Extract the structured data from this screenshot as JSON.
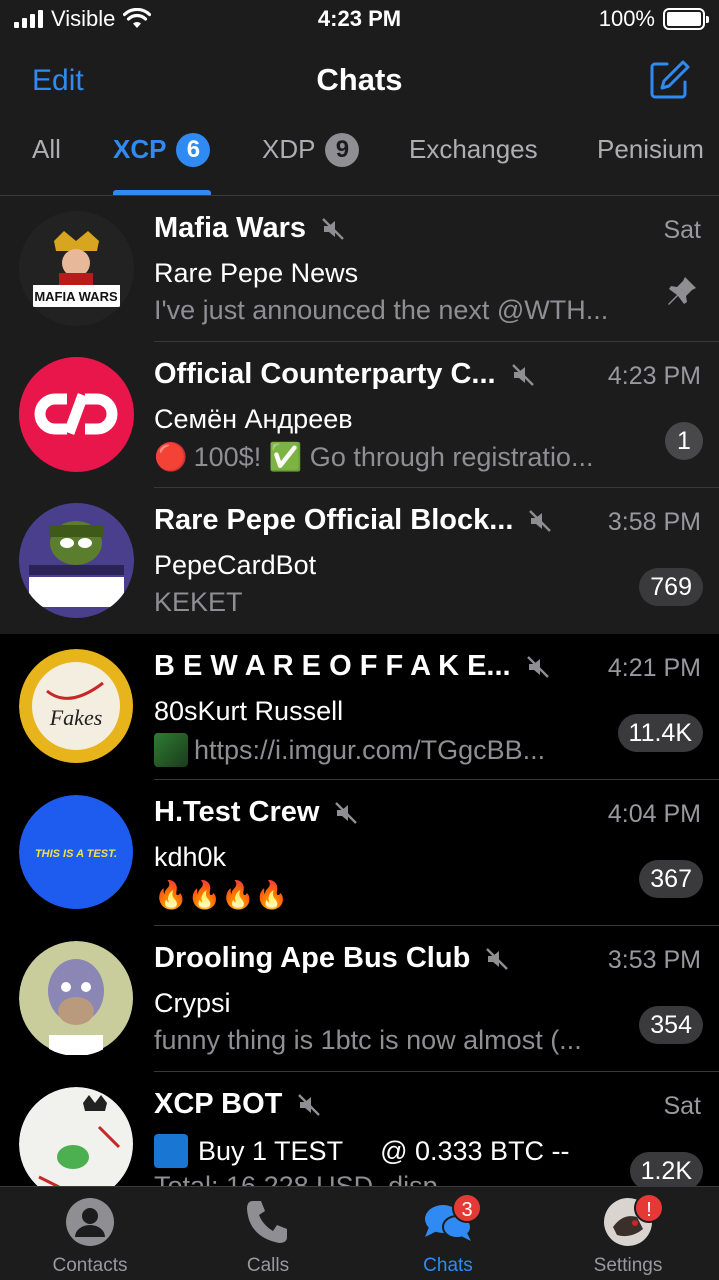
{
  "status_bar": {
    "carrier": "Visible",
    "time": "4:23 PM",
    "battery": "100%"
  },
  "header": {
    "edit_label": "Edit",
    "title": "Chats"
  },
  "folder_tabs": [
    {
      "label": "All",
      "badge": ""
    },
    {
      "label": "XCP",
      "badge": "6"
    },
    {
      "label": "XDP",
      "badge": "9"
    },
    {
      "label": "Exchanges",
      "badge": ""
    },
    {
      "label": "Penisium",
      "badge": ""
    }
  ],
  "active_tab": "XCP",
  "chats": [
    {
      "name": "Mafia Wars",
      "time": "Sat",
      "sender": "Rare Pepe News",
      "preview": "I've just announced the next @WTH...",
      "unread": "",
      "pinned": true,
      "muted": true,
      "avatar_text": "MAFIA WARS"
    },
    {
      "name": "Official Counterparty C...",
      "time": "4:23 PM",
      "sender": "Семён Андреев",
      "preview_prefix": "🔴",
      "preview": "100$! ✅ Go through registratio...",
      "unread": "1",
      "pinned": true,
      "muted": true
    },
    {
      "name": "Rare Pepe Official Block...",
      "time": "3:58 PM",
      "sender": "PepeCardBot",
      "preview": "KEKET",
      "unread": "769",
      "pinned": true,
      "muted": true
    },
    {
      "name": "B E W A R E O F F A K E...",
      "time": "4:21 PM",
      "sender": "80sKurt Russell",
      "preview": "https://i.imgur.com/TGgcBB...",
      "unread": "11.4K",
      "pinned": false,
      "muted": true,
      "avatar_text": "Fakes"
    },
    {
      "name": "H.Test Crew",
      "time": "4:04 PM",
      "sender": "kdh0k",
      "preview": "🔥🔥🔥🔥",
      "unread": "367",
      "pinned": false,
      "muted": true,
      "avatar_text": "THIS IS A TEST."
    },
    {
      "name": "Drooling Ape Bus Club",
      "time": "3:53 PM",
      "sender": "Crypsi",
      "preview": "funny thing is 1btc is now almost (...",
      "unread": "354",
      "pinned": false,
      "muted": true
    },
    {
      "name": "XCP BOT",
      "time": "Sat",
      "sender": "Buy 1 TEST     @ 0.333 BTC --",
      "preview": "Total: 16.228 USD, disp...",
      "unread": "1.2K",
      "pinned": false,
      "muted": true
    }
  ],
  "tab_bar": [
    {
      "label": "Contacts",
      "icon": "person-icon",
      "badge": ""
    },
    {
      "label": "Calls",
      "icon": "phone-icon",
      "badge": ""
    },
    {
      "label": "Chats",
      "icon": "chat-bubbles-icon",
      "badge": "3"
    },
    {
      "label": "Settings",
      "icon": "profile-avatar-icon",
      "badge": "!"
    }
  ],
  "colors": {
    "accent": "#2f8bf3",
    "background": "#000000",
    "panel": "#1c1c1d",
    "badge_red": "#e53935"
  }
}
